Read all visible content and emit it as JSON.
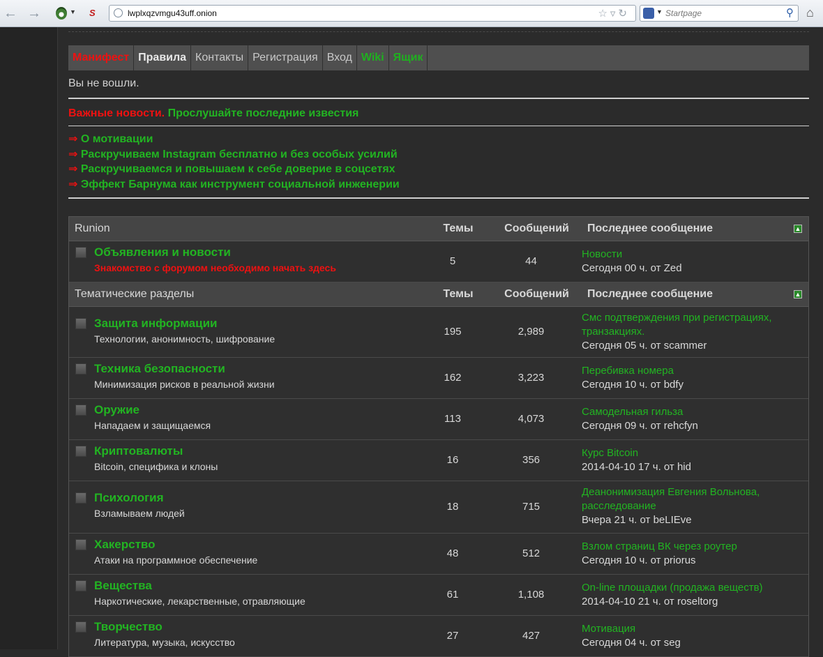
{
  "browser": {
    "url": "lwplxqzvmgu43uff.onion",
    "search_placeholder": "Startpage"
  },
  "nav": [
    "Манифест",
    "Правила",
    "Контакты",
    "Регистрация",
    "Вход",
    "Wiki",
    "Ящик"
  ],
  "status": "Вы не вошли.",
  "news": {
    "label": "Важные новости.",
    "text": "Прослушайте последние известия"
  },
  "links": [
    "О мотивации",
    "Раскручиваем Instagram бесплатно и без особых усилий",
    "Раскручиваемся и повышаем к себе доверие в соцсетях",
    "Эффект Барнума как инструмент социальной инженерии"
  ],
  "columns": {
    "topics": "Темы",
    "posts": "Сообщений",
    "last": "Последнее сообщение"
  },
  "categories": [
    {
      "name": "Runion",
      "forums": [
        {
          "title": "Объявления и новости",
          "desc": "Знакомство с форумом необходимо начать здесь",
          "topics": "5",
          "posts": "44",
          "last_title": "Новости",
          "last_meta": "Сегодня 00 ч. от Zed"
        }
      ]
    },
    {
      "name": "Тематические разделы",
      "forums": [
        {
          "title": "Защита информации",
          "desc": "Технологии, анонимность, шифрование",
          "topics": "195",
          "posts": "2,989",
          "last_title": "Смс подтверждения при регистрациях, транзакциях.",
          "last_meta": "Сегодня 05 ч. от scammer"
        },
        {
          "title": "Техника безопасности",
          "desc": "Минимизация рисков в реальной жизни",
          "topics": "162",
          "posts": "3,223",
          "last_title": "Перебивка номера",
          "last_meta": "Сегодня 10 ч. от bdfy"
        },
        {
          "title": "Оружие",
          "desc": "Нападаем и защищаемся",
          "topics": "113",
          "posts": "4,073",
          "last_title": "Самодельная гильза",
          "last_meta": "Сегодня 09 ч. от rehcfyn"
        },
        {
          "title": "Криптовалюты",
          "desc": "Bitcoin, специфика и клоны",
          "topics": "16",
          "posts": "356",
          "last_title": "Курс Bitcoin",
          "last_meta": "2014-04-10 17 ч. от hid"
        },
        {
          "title": "Психология",
          "desc": "Взламываем людей",
          "topics": "18",
          "posts": "715",
          "last_title": "Деанонимизация Евгения Вольнова, расследование",
          "last_meta": "Вчера 21 ч. от beLIEve"
        },
        {
          "title": "Хакерство",
          "desc": "Атаки на программное обеспечение",
          "topics": "48",
          "posts": "512",
          "last_title": "Взлом страниц ВК через роутер",
          "last_meta": "Сегодня 10 ч. от priorus"
        },
        {
          "title": "Вещества",
          "desc": "Наркотические, лекарственные, отравляющие",
          "topics": "61",
          "posts": "1,108",
          "last_title": "On-line площадки (продажа веществ)",
          "last_meta": "2014-04-10 21 ч. от roseltorg"
        },
        {
          "title": "Творчество",
          "desc": "Литература, музыка, искусство",
          "topics": "27",
          "posts": "427",
          "last_title": "Мотивация",
          "last_meta": "Сегодня 04 ч. от seg"
        }
      ]
    }
  ],
  "colors": {
    "accent_green": "#22b422",
    "accent_red": "#e11111",
    "background": "#2b2b2b"
  }
}
